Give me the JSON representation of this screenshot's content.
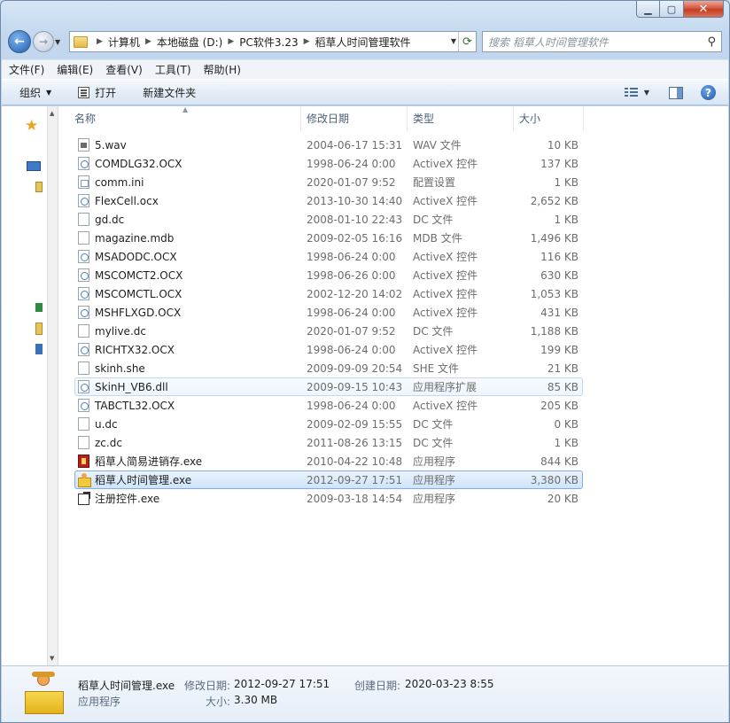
{
  "address": {
    "crumbs": [
      "计算机",
      "本地磁盘 (D:)",
      "PC软件3.23",
      "稻草人时间管理软件"
    ]
  },
  "search": {
    "placeholder": "搜索 稻草人时间管理软件"
  },
  "menu": [
    "文件(F)",
    "编辑(E)",
    "查看(V)",
    "工具(T)",
    "帮助(H)"
  ],
  "toolbar": {
    "organize": "组织",
    "open": "打开",
    "new_folder": "新建文件夹"
  },
  "columns": {
    "name": "名称",
    "date": "修改日期",
    "type": "类型",
    "size": "大小"
  },
  "files": [
    {
      "name": "5.wav",
      "date": "2004-06-17 15:31",
      "type": "WAV 文件",
      "size": "10 KB",
      "icon": "wav"
    },
    {
      "name": "COMDLG32.OCX",
      "date": "1998-06-24 0:00",
      "type": "ActiveX 控件",
      "size": "137 KB",
      "icon": "ocx"
    },
    {
      "name": "comm.ini",
      "date": "2020-01-07 9:52",
      "type": "配置设置",
      "size": "1 KB",
      "icon": "ini"
    },
    {
      "name": "FlexCell.ocx",
      "date": "2013-10-30 14:40",
      "type": "ActiveX 控件",
      "size": "2,652 KB",
      "icon": "ocx"
    },
    {
      "name": "gd.dc",
      "date": "2008-01-10 22:43",
      "type": "DC 文件",
      "size": "1 KB",
      "icon": "blank"
    },
    {
      "name": "magazine.mdb",
      "date": "2009-02-05 16:16",
      "type": "MDB 文件",
      "size": "1,496 KB",
      "icon": "blank"
    },
    {
      "name": "MSADODC.OCX",
      "date": "1998-06-24 0:00",
      "type": "ActiveX 控件",
      "size": "116 KB",
      "icon": "ocx"
    },
    {
      "name": "MSCOMCT2.OCX",
      "date": "1998-06-26 0:00",
      "type": "ActiveX 控件",
      "size": "630 KB",
      "icon": "ocx"
    },
    {
      "name": "MSCOMCTL.OCX",
      "date": "2002-12-20 14:02",
      "type": "ActiveX 控件",
      "size": "1,053 KB",
      "icon": "ocx"
    },
    {
      "name": "MSHFLXGD.OCX",
      "date": "1998-06-24 0:00",
      "type": "ActiveX 控件",
      "size": "431 KB",
      "icon": "ocx"
    },
    {
      "name": "mylive.dc",
      "date": "2020-01-07 9:52",
      "type": "DC 文件",
      "size": "1,188 KB",
      "icon": "blank"
    },
    {
      "name": "RICHTX32.OCX",
      "date": "1998-06-24 0:00",
      "type": "ActiveX 控件",
      "size": "199 KB",
      "icon": "ocx"
    },
    {
      "name": "skinh.she",
      "date": "2009-09-09 20:54",
      "type": "SHE 文件",
      "size": "21 KB",
      "icon": "blank"
    },
    {
      "name": "SkinH_VB6.dll",
      "date": "2009-09-15 10:43",
      "type": "应用程序扩展",
      "size": "85 KB",
      "icon": "ocx",
      "state": "hover"
    },
    {
      "name": "TABCTL32.OCX",
      "date": "1998-06-24 0:00",
      "type": "ActiveX 控件",
      "size": "205 KB",
      "icon": "ocx"
    },
    {
      "name": "u.dc",
      "date": "2009-02-09 15:55",
      "type": "DC 文件",
      "size": "0 KB",
      "icon": "blank"
    },
    {
      "name": "zc.dc",
      "date": "2011-08-26 13:15",
      "type": "DC 文件",
      "size": "1 KB",
      "icon": "blank"
    },
    {
      "name": "稻草人简易进销存.exe",
      "date": "2010-04-22 10:48",
      "type": "应用程序",
      "size": "844 KB",
      "icon": "exe-red"
    },
    {
      "name": "稻草人时间管理.exe",
      "date": "2012-09-27 17:51",
      "type": "应用程序",
      "size": "3,380 KB",
      "icon": "exe-app",
      "state": "selected"
    },
    {
      "name": "注册控件.exe",
      "date": "2009-03-18 14:54",
      "type": "应用程序",
      "size": "20 KB",
      "icon": "exe-reg"
    }
  ],
  "details": {
    "name": "稻草人时间管理.exe",
    "type": "应用程序",
    "modified_label": "修改日期:",
    "modified_value": "2012-09-27 17:51",
    "created_label": "创建日期:",
    "created_value": "2020-03-23 8:55",
    "size_label": "大小:",
    "size_value": "3.30 MB"
  }
}
